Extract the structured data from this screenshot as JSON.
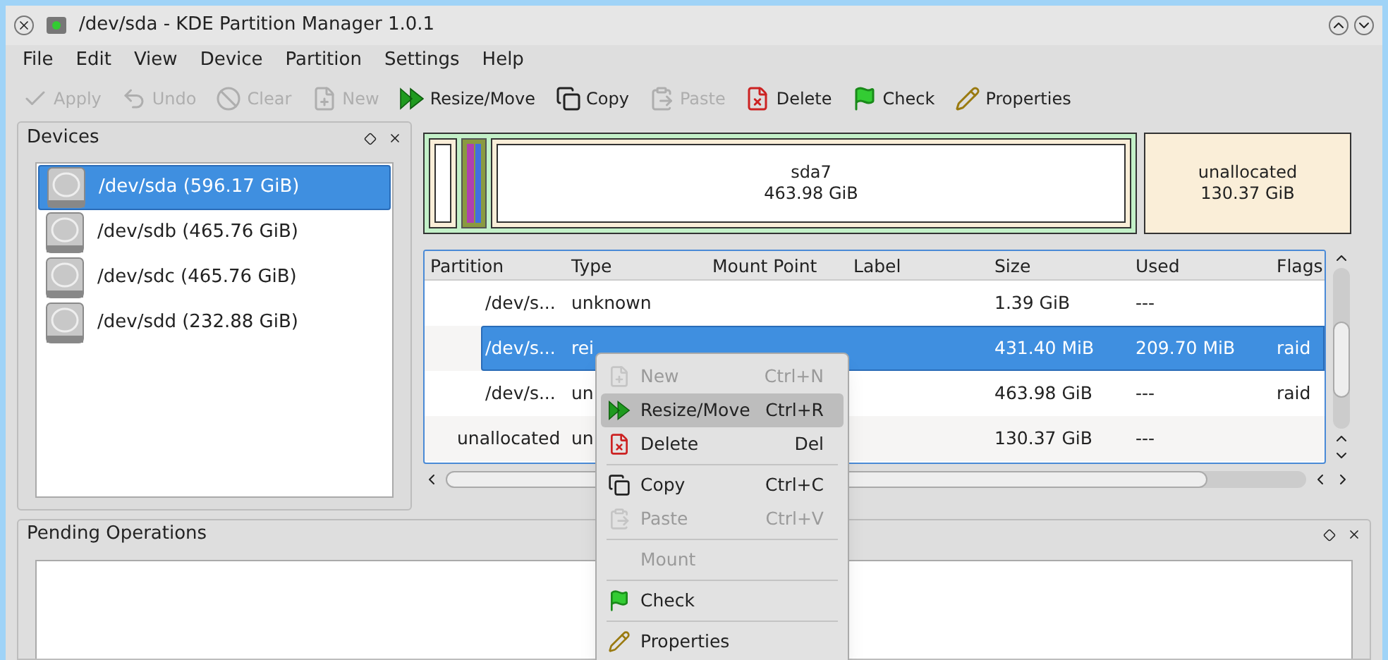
{
  "window": {
    "title": "/dev/sda - KDE Partition Manager 1.0.1"
  },
  "menu": [
    "File",
    "Edit",
    "View",
    "Device",
    "Partition",
    "Settings",
    "Help"
  ],
  "toolbar": [
    {
      "kind": "apply",
      "label": "Apply",
      "disabled": true
    },
    {
      "kind": "undo",
      "label": "Undo",
      "disabled": true
    },
    {
      "kind": "clear",
      "label": "Clear",
      "disabled": true
    },
    {
      "kind": "new",
      "label": "New",
      "disabled": true
    },
    {
      "kind": "resize",
      "label": "Resize/Move",
      "disabled": false
    },
    {
      "kind": "copy",
      "label": "Copy",
      "disabled": false
    },
    {
      "kind": "paste",
      "label": "Paste",
      "disabled": true
    },
    {
      "kind": "delete",
      "label": "Delete",
      "disabled": false
    },
    {
      "kind": "check",
      "label": "Check",
      "disabled": false
    },
    {
      "kind": "properties",
      "label": "Properties",
      "disabled": false
    }
  ],
  "devices": {
    "title": "Devices",
    "items": [
      {
        "label": "/dev/sda (596.17 GiB)",
        "selected": true
      },
      {
        "label": "/dev/sdb (465.76 GiB)",
        "selected": false
      },
      {
        "label": "/dev/sdc (465.76 GiB)",
        "selected": false
      },
      {
        "label": "/dev/sdd (232.88 GiB)",
        "selected": false
      }
    ]
  },
  "disk_map": {
    "main": {
      "name": "sda7",
      "size": "463.98 GiB"
    },
    "unallocated": {
      "name": "unallocated",
      "size": "130.37 GiB"
    }
  },
  "table": {
    "columns": [
      "Partition",
      "Type",
      "Mount Point",
      "Label",
      "Size",
      "Used",
      "Flags"
    ],
    "rows": [
      {
        "kind": "logical",
        "selected": false,
        "partition": "/dev/s...",
        "type": "unknown",
        "size": "1.39 GiB",
        "used": "---"
      },
      {
        "kind": "logical",
        "selected": true,
        "partition": "/dev/s...",
        "type": "rei",
        "size": "431.40 MiB",
        "used": "209.70 MiB",
        "flags": "raid"
      },
      {
        "kind": "logical",
        "selected": false,
        "partition": "/dev/s...",
        "type": "un",
        "size": "463.98 GiB",
        "used": "---",
        "flags": "raid"
      },
      {
        "kind": "primary",
        "selected": false,
        "partition": "unallocated",
        "type": "un",
        "size": "130.37 GiB",
        "used": "---"
      }
    ]
  },
  "pending": {
    "title": "Pending Operations"
  },
  "context_menu": [
    {
      "kind": "item",
      "label": "New",
      "shortcut": "Ctrl+N",
      "disabled": true,
      "selected": false
    },
    {
      "kind": "item",
      "label": "Resize/Move",
      "shortcut": "Ctrl+R",
      "disabled": false,
      "selected": true
    },
    {
      "kind": "item",
      "label": "Delete",
      "shortcut": "Del",
      "disabled": false,
      "selected": false
    },
    {
      "kind": "separator"
    },
    {
      "kind": "item",
      "label": "Copy",
      "shortcut": "Ctrl+C",
      "disabled": false,
      "selected": false
    },
    {
      "kind": "item",
      "label": "Paste",
      "shortcut": "Ctrl+V",
      "disabled": true,
      "selected": false
    },
    {
      "kind": "separator"
    },
    {
      "kind": "item",
      "label": "Mount",
      "disabled": true,
      "selected": false
    },
    {
      "kind": "separator"
    },
    {
      "kind": "item",
      "label": "Check",
      "disabled": false,
      "selected": false
    },
    {
      "kind": "separator"
    },
    {
      "kind": "item",
      "label": "Properties",
      "disabled": false,
      "selected": false
    }
  ]
}
